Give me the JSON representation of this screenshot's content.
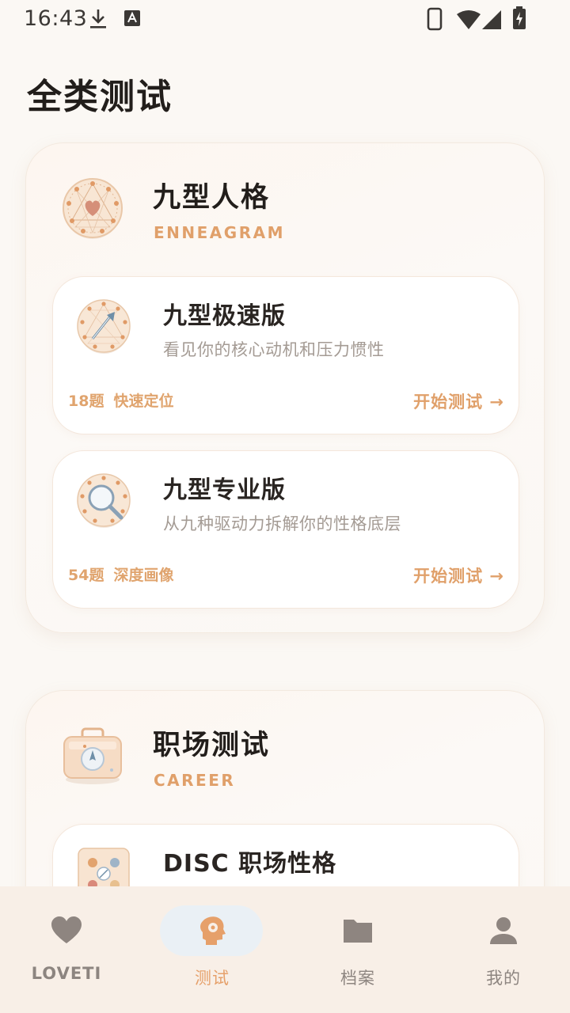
{
  "status_bar": {
    "time": "16:43",
    "icons": [
      "download-icon",
      "text-a-icon",
      "phone-icon",
      "wifi-icon",
      "signal-icon",
      "battery-charging-icon"
    ]
  },
  "page": {
    "title": "全类测试"
  },
  "sections": [
    {
      "title": "九型人格",
      "subtitle": "ENNEAGRAM",
      "emblem": "enneagram-emblem-icon",
      "cards": [
        {
          "title": "九型极速版",
          "desc": "看见你的核心动机和压力惯性",
          "count": "18题",
          "tag": "快速定位",
          "action": "开始测试 →",
          "icon": "enneagram-arrow-icon"
        },
        {
          "title": "九型专业版",
          "desc": "从九种驱动力拆解你的性格底层",
          "count": "54题",
          "tag": "深度画像",
          "action": "开始测试 →",
          "icon": "enneagram-magnifier-icon"
        }
      ]
    },
    {
      "title": "职场测试",
      "subtitle": "CAREER",
      "emblem": "briefcase-compass-icon",
      "cards": [
        {
          "title": "DISC 职场性格",
          "icon": "disc-board-icon"
        }
      ]
    }
  ],
  "bottom_nav": [
    {
      "label": "LOVETI",
      "icon": "heart-icon",
      "active": false
    },
    {
      "label": "测试",
      "icon": "brain-gear-icon",
      "active": true
    },
    {
      "label": "档案",
      "icon": "folder-icon",
      "active": false
    },
    {
      "label": "我的",
      "icon": "person-icon",
      "active": false
    }
  ],
  "colors": {
    "accent": "#e0a06a",
    "background": "#fbf8f4",
    "nav_bg": "#f8efe7",
    "active_pill": "#eaf0f5"
  }
}
